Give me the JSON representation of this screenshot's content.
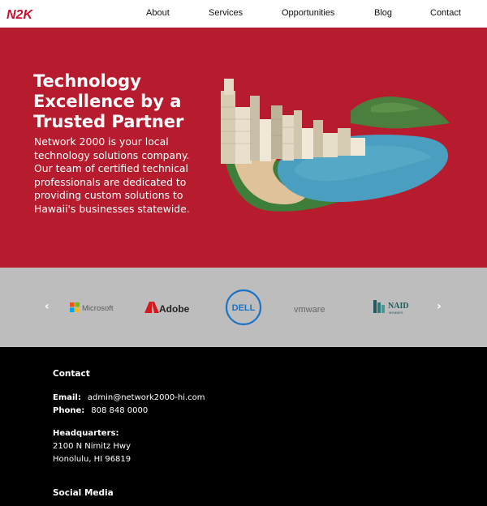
{
  "nav": {
    "logo_text": "N2K",
    "links": [
      "About",
      "Services",
      "Opportunities",
      "Blog",
      "Contact"
    ]
  },
  "hero": {
    "title": "Technology Excellence by a Trusted Partner",
    "body": "Network 2000 is your local technology solutions company. Our team of certified technical professionals are dedicated to providing custom solutions to Hawaii's businesses statewide."
  },
  "partners": {
    "prev_icon": "chevron-left-icon",
    "next_icon": "chevron-right-icon",
    "logos": {
      "microsoft": "Microsoft",
      "adobe": "Adobe",
      "dell": "DELL",
      "vmware": "vmware",
      "naid": "NAID",
      "naid_sub": "MEMBER"
    }
  },
  "footer": {
    "contact_heading": "Contact",
    "email_label": "Email:",
    "email_value": "admin@network2000-hi.com",
    "phone_label": "Phone:",
    "phone_value": "808 848 0000",
    "hq_label": "Headquarters:",
    "address_line1": "2100 N Nimitz Hwy",
    "address_line2": "Honolulu, HI 96819",
    "social_heading": "Social Media"
  },
  "colors": {
    "brand_red": "#b71c2e",
    "partner_bg": "#bdbdbd",
    "footer_bg": "#000000"
  }
}
